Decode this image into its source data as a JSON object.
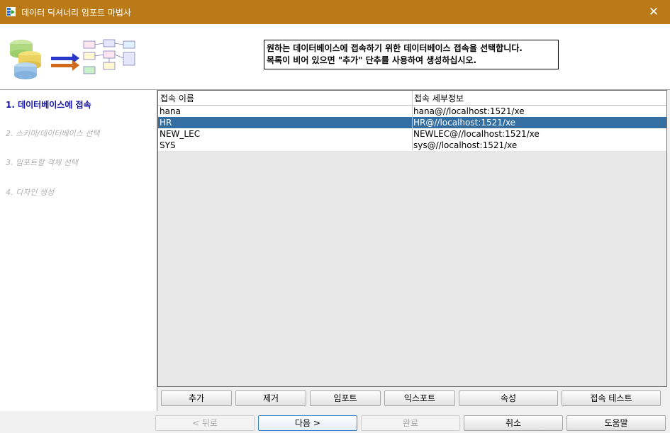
{
  "window": {
    "title": "데이터 딕셔너리 임포트 마법사",
    "close_glyph": "✕"
  },
  "header": {
    "instruction_line1": "원하는 데이터베이스에 접속하기 위한 데이터베이스 접속을 선택합니다.",
    "instruction_line2": "목록이 비어 있으면 \"추가\" 단추를 사용하여 생성하십시오."
  },
  "steps": [
    {
      "label": "1. 데이터베이스에 접속",
      "active": true
    },
    {
      "label": "2. 스키마/데이터베이스 선택",
      "active": false
    },
    {
      "label": "3. 임포트할 객체 선택",
      "active": false
    },
    {
      "label": "4. 디자인 생성",
      "active": false
    }
  ],
  "table": {
    "columns": [
      "접속 이름",
      "접속 세부정보"
    ],
    "rows": [
      {
        "name": "hana",
        "details": "hana@//localhost:1521/xe",
        "selected": false
      },
      {
        "name": "HR",
        "details": "HR@//localhost:1521/xe",
        "selected": true
      },
      {
        "name": "NEW_LEC",
        "details": "NEWLEC@//localhost:1521/xe",
        "selected": false
      },
      {
        "name": "SYS",
        "details": "sys@//localhost:1521/xe",
        "selected": false
      }
    ]
  },
  "actions": {
    "add": "추가",
    "remove": "제거",
    "import": "임포트",
    "export": "익스포트",
    "properties": "속성",
    "test": "접속 테스트"
  },
  "nav": {
    "back": "< 뒤로",
    "next": "다음 >",
    "finish": "완료",
    "cancel": "취소",
    "help": "도움말"
  }
}
